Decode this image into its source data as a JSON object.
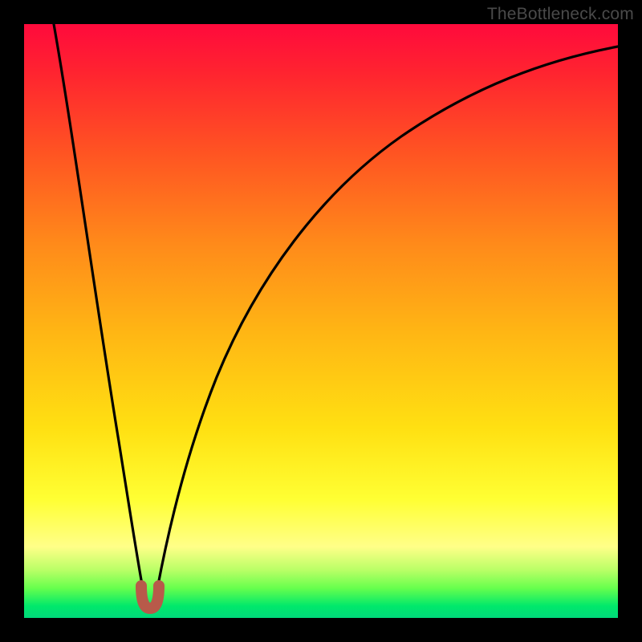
{
  "watermark": "TheBottleneck.com",
  "chart_data": {
    "type": "line",
    "title": "",
    "xlabel": "",
    "ylabel": "",
    "xlim": [
      0,
      100
    ],
    "ylim": [
      0,
      100
    ],
    "series": [
      {
        "name": "bottleneck-curve",
        "x": [
          5,
          7,
          9,
          11,
          13,
          15,
          17,
          18.5,
          19.5,
          20.5,
          21.5,
          23,
          25,
          28,
          32,
          37,
          43,
          50,
          58,
          67,
          77,
          88,
          100
        ],
        "y": [
          100,
          86,
          73,
          60,
          47,
          34,
          20,
          8,
          2,
          2,
          8,
          20,
          32,
          44,
          54,
          63,
          71,
          78,
          83,
          87.5,
          91,
          94,
          96
        ]
      },
      {
        "name": "min-marker",
        "x": [
          19,
          19.5,
          20,
          20.5,
          21
        ],
        "y": [
          4,
          2,
          1.5,
          2,
          4
        ]
      }
    ],
    "colors": {
      "curve": "#000000",
      "marker": "#b85a4a",
      "gradient_top": "#ff0a3c",
      "gradient_bottom": "#00d97a"
    }
  }
}
